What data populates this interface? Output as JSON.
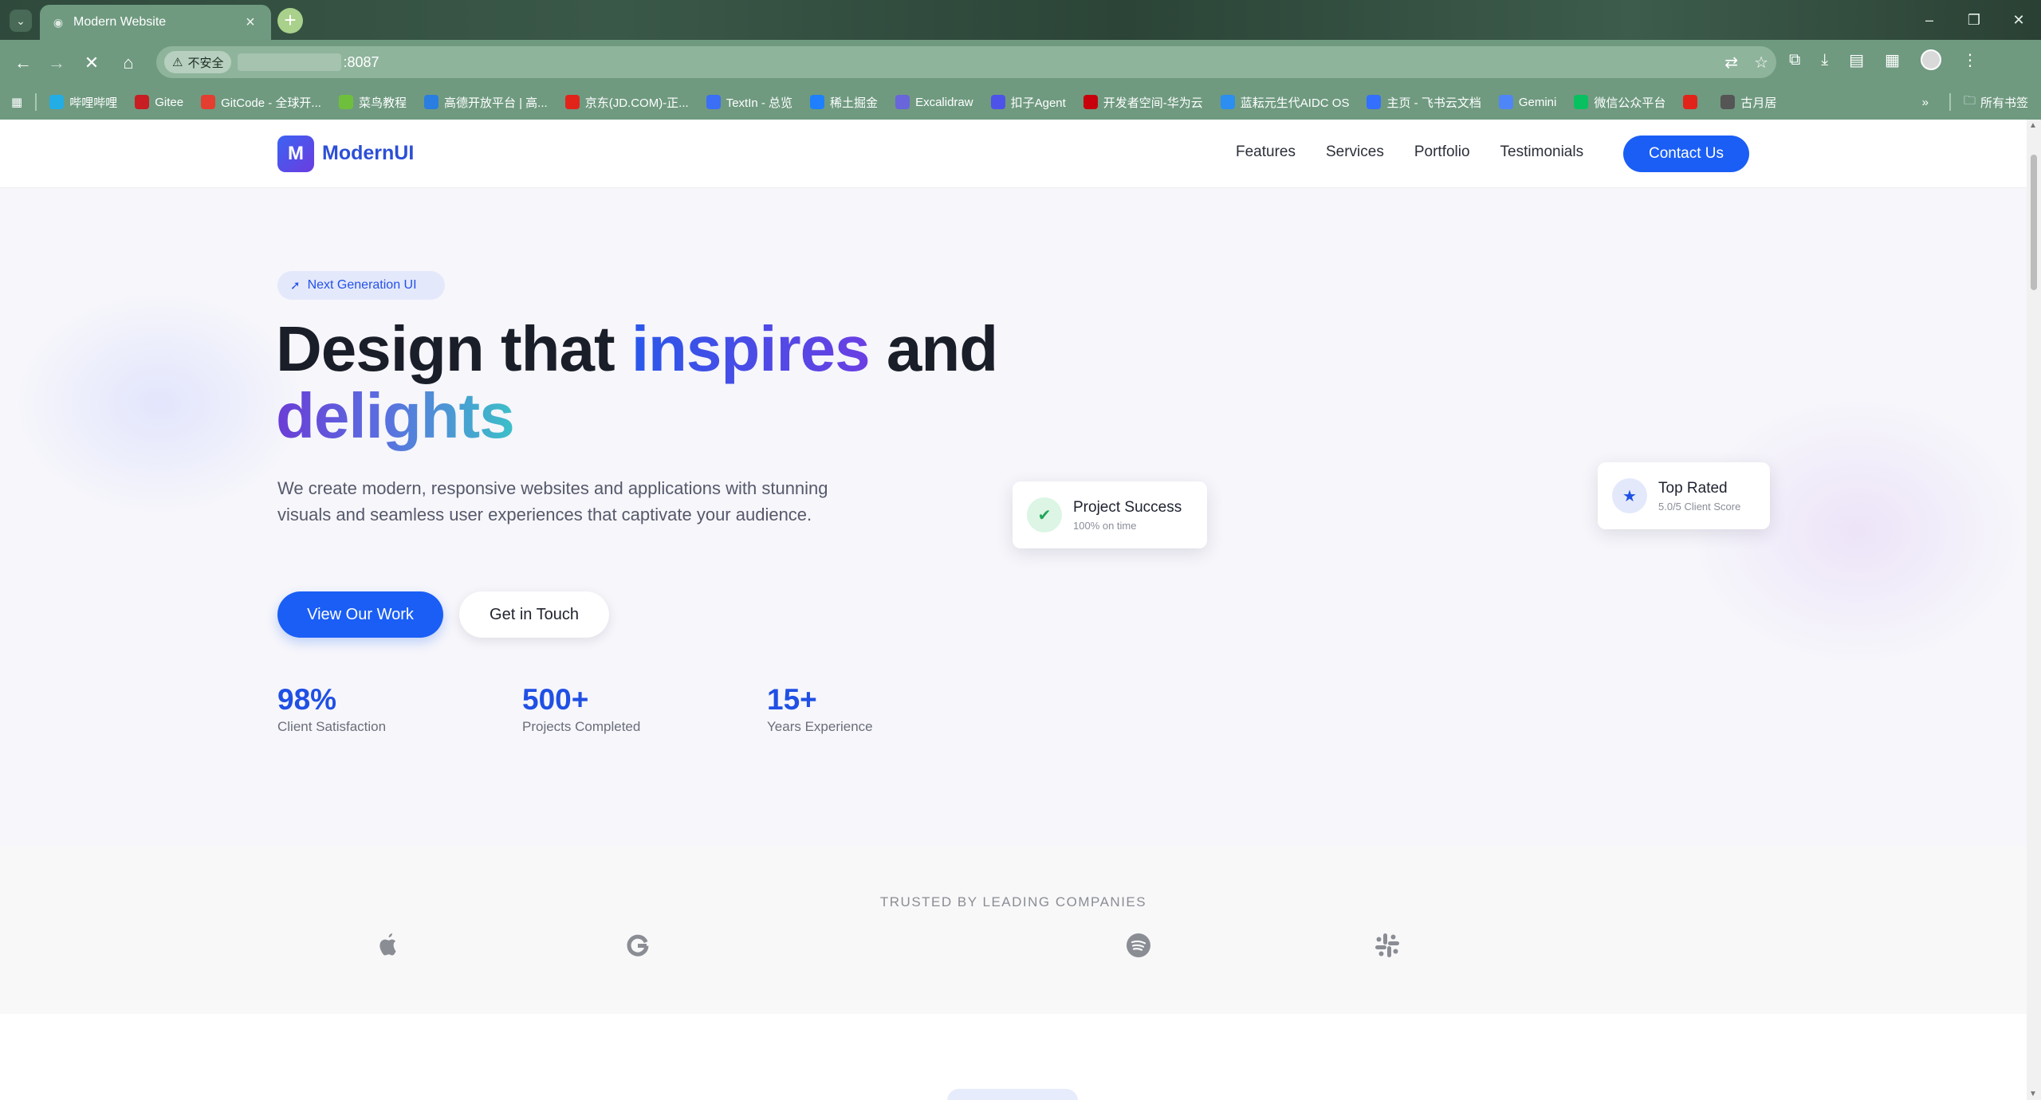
{
  "browser": {
    "tab_title": "Modern Website",
    "security_label": "不安全",
    "url_visible": ":8087"
  },
  "bookmarks": [
    {
      "label": "哔哩哔哩",
      "color": "#23ade5"
    },
    {
      "label": "Gitee",
      "color": "#c71d23"
    },
    {
      "label": "GitCode - 全球开...",
      "color": "#e33e2f"
    },
    {
      "label": "菜鸟教程",
      "color": "#6fbf3c"
    },
    {
      "label": "高德开放平台 | 高...",
      "color": "#2a7de1"
    },
    {
      "label": "京东(JD.COM)-正...",
      "color": "#e2231a"
    },
    {
      "label": "TextIn - 总览",
      "color": "#3b6ff5"
    },
    {
      "label": "稀土掘金",
      "color": "#1e80ff"
    },
    {
      "label": "Excalidraw",
      "color": "#6965db"
    },
    {
      "label": "扣子Agent",
      "color": "#4d53e8"
    },
    {
      "label": "开发者空间-华为云",
      "color": "#c7000b"
    },
    {
      "label": "蓝耘元生代AIDC OS",
      "color": "#2b8ef0"
    },
    {
      "label": "主页 - 飞书云文档",
      "color": "#3370ff"
    },
    {
      "label": "Gemini",
      "color": "#4f86f7"
    },
    {
      "label": "微信公众平台",
      "color": "#07c160"
    },
    {
      "label": "",
      "color": "#e2231a"
    },
    {
      "label": "古月居",
      "color": "#555555"
    }
  ],
  "bookmarks_all": "所有书签",
  "site": {
    "logo_letter": "M",
    "logo_text": "ModernUI",
    "nav": [
      "Features",
      "Services",
      "Portfolio",
      "Testimonials"
    ],
    "contact_label": "Contact Us"
  },
  "hero": {
    "badge": "Next Generation UI",
    "headline_part1": "Design that ",
    "headline_highlight": "inspires",
    "headline_part2": " and",
    "headline_line2": "delights",
    "description": "We create modern, responsive websites and applications with stunning visuals and seamless user experiences that captivate your audience.",
    "primary_cta": "View Our Work",
    "secondary_cta": "Get in Touch",
    "stats": [
      {
        "value": "98%",
        "label": "Client Satisfaction"
      },
      {
        "value": "500+",
        "label": "Projects Completed"
      },
      {
        "value": "15+",
        "label": "Years Experience"
      }
    ]
  },
  "cards": {
    "success_title": "Project Success",
    "success_sub": "100% on time",
    "rated_title": "Top Rated",
    "rated_sub": "5.0/5 Client Score"
  },
  "trusted": {
    "title": "TRUSTED BY LEADING COMPANIES",
    "logos": [
      "apple-icon",
      "google-icon",
      "spotify-icon",
      "slack-icon"
    ]
  },
  "colors": {
    "primary": "#1a5ef5",
    "chrome": "#6f9a80",
    "stat_blue": "#2050e4",
    "success_green": "#22a55a"
  }
}
